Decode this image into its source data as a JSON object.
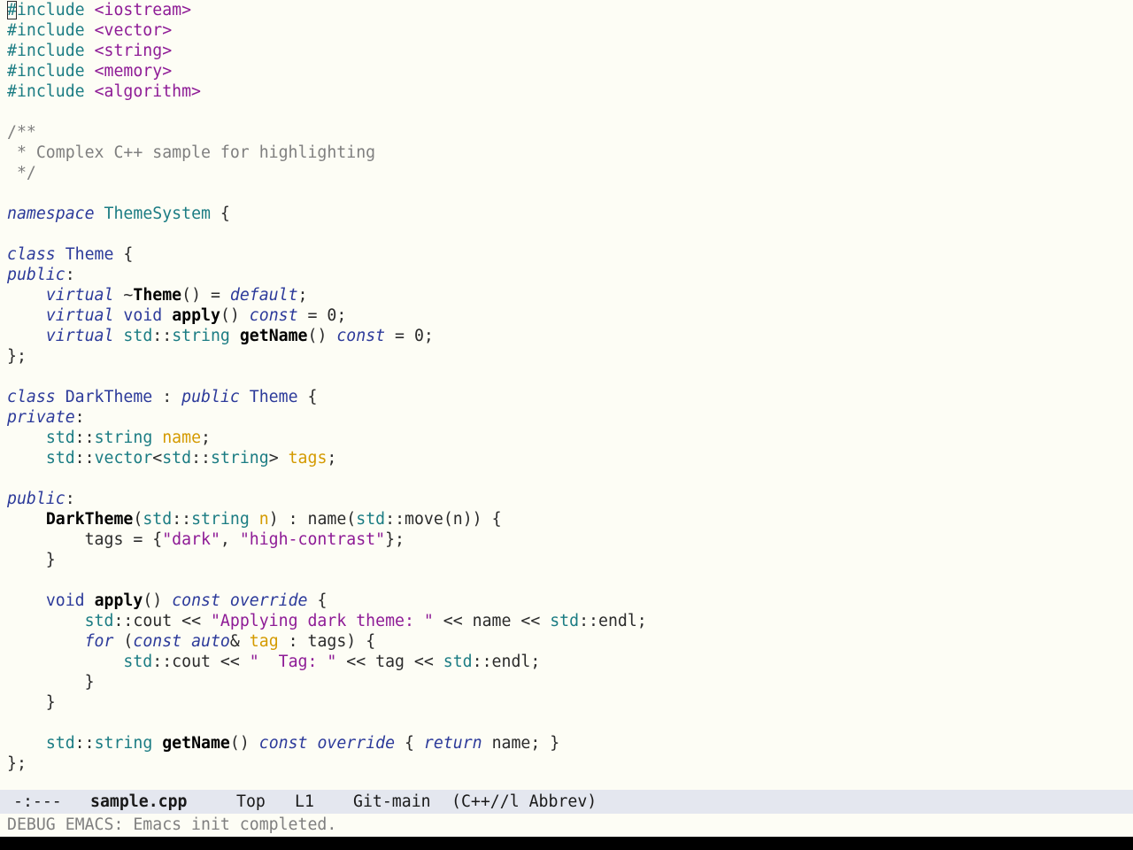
{
  "editor": {
    "lines": [
      [
        {
          "t": "#",
          "c": "pp cursor"
        },
        {
          "t": "include ",
          "c": "pp"
        },
        {
          "t": "<iostream>",
          "c": "str"
        }
      ],
      [
        {
          "t": "#include ",
          "c": "pp"
        },
        {
          "t": "<vector>",
          "c": "str"
        }
      ],
      [
        {
          "t": "#include ",
          "c": "pp"
        },
        {
          "t": "<string>",
          "c": "str"
        }
      ],
      [
        {
          "t": "#include ",
          "c": "pp"
        },
        {
          "t": "<memory>",
          "c": "str"
        }
      ],
      [
        {
          "t": "#include ",
          "c": "pp"
        },
        {
          "t": "<algorithm>",
          "c": "str"
        }
      ],
      [],
      [
        {
          "t": "/**",
          "c": "cm"
        }
      ],
      [
        {
          "t": " * Complex C++ sample for highlighting",
          "c": "cm"
        }
      ],
      [
        {
          "t": " */",
          "c": "cm"
        }
      ],
      [],
      [
        {
          "t": "namespace",
          "c": "kw"
        },
        {
          "t": " "
        },
        {
          "t": "ThemeSystem",
          "c": "ns"
        },
        {
          "t": " {"
        }
      ],
      [],
      [
        {
          "t": "class",
          "c": "kw"
        },
        {
          "t": " "
        },
        {
          "t": "Theme",
          "c": "cls"
        },
        {
          "t": " {"
        }
      ],
      [
        {
          "t": "public",
          "c": "kw"
        },
        {
          "t": ":"
        }
      ],
      [
        {
          "t": "    "
        },
        {
          "t": "virtual",
          "c": "kw"
        },
        {
          "t": " ~"
        },
        {
          "t": "Theme",
          "c": "fn"
        },
        {
          "t": "() = "
        },
        {
          "t": "default",
          "c": "kw"
        },
        {
          "t": ";"
        }
      ],
      [
        {
          "t": "    "
        },
        {
          "t": "virtual",
          "c": "kw"
        },
        {
          "t": " "
        },
        {
          "t": "void",
          "c": "cls"
        },
        {
          "t": " "
        },
        {
          "t": "apply",
          "c": "fn"
        },
        {
          "t": "() "
        },
        {
          "t": "const",
          "c": "kw"
        },
        {
          "t": " = 0;"
        }
      ],
      [
        {
          "t": "    "
        },
        {
          "t": "virtual",
          "c": "kw"
        },
        {
          "t": " "
        },
        {
          "t": "std",
          "c": "ty"
        },
        {
          "t": "::"
        },
        {
          "t": "string",
          "c": "ty"
        },
        {
          "t": " "
        },
        {
          "t": "getName",
          "c": "fn"
        },
        {
          "t": "() "
        },
        {
          "t": "const",
          "c": "kw"
        },
        {
          "t": " = 0;"
        }
      ],
      [
        {
          "t": "};"
        }
      ],
      [],
      [
        {
          "t": "class",
          "c": "kw"
        },
        {
          "t": " "
        },
        {
          "t": "DarkTheme",
          "c": "cls"
        },
        {
          "t": " : "
        },
        {
          "t": "public",
          "c": "kw"
        },
        {
          "t": " "
        },
        {
          "t": "Theme",
          "c": "cls"
        },
        {
          "t": " {"
        }
      ],
      [
        {
          "t": "private",
          "c": "kw"
        },
        {
          "t": ":"
        }
      ],
      [
        {
          "t": "    "
        },
        {
          "t": "std",
          "c": "ty"
        },
        {
          "t": "::"
        },
        {
          "t": "string",
          "c": "ty"
        },
        {
          "t": " "
        },
        {
          "t": "name",
          "c": "var"
        },
        {
          "t": ";"
        }
      ],
      [
        {
          "t": "    "
        },
        {
          "t": "std",
          "c": "ty"
        },
        {
          "t": "::"
        },
        {
          "t": "vector",
          "c": "ty"
        },
        {
          "t": "<"
        },
        {
          "t": "std",
          "c": "ty"
        },
        {
          "t": "::"
        },
        {
          "t": "string",
          "c": "ty"
        },
        {
          "t": "> "
        },
        {
          "t": "tags",
          "c": "var"
        },
        {
          "t": ";"
        }
      ],
      [],
      [
        {
          "t": "public",
          "c": "kw"
        },
        {
          "t": ":"
        }
      ],
      [
        {
          "t": "    "
        },
        {
          "t": "DarkTheme",
          "c": "fn"
        },
        {
          "t": "("
        },
        {
          "t": "std",
          "c": "ty"
        },
        {
          "t": "::"
        },
        {
          "t": "string",
          "c": "ty"
        },
        {
          "t": " "
        },
        {
          "t": "n",
          "c": "var"
        },
        {
          "t": ") : name("
        },
        {
          "t": "std",
          "c": "ty"
        },
        {
          "t": "::move(n)) {"
        }
      ],
      [
        {
          "t": "        tags = {"
        },
        {
          "t": "\"dark\"",
          "c": "str"
        },
        {
          "t": ", "
        },
        {
          "t": "\"high-contrast\"",
          "c": "str"
        },
        {
          "t": "};"
        }
      ],
      [
        {
          "t": "    }"
        }
      ],
      [],
      [
        {
          "t": "    "
        },
        {
          "t": "void",
          "c": "cls"
        },
        {
          "t": " "
        },
        {
          "t": "apply",
          "c": "fn"
        },
        {
          "t": "() "
        },
        {
          "t": "const",
          "c": "kw"
        },
        {
          "t": " "
        },
        {
          "t": "override",
          "c": "kw"
        },
        {
          "t": " {"
        }
      ],
      [
        {
          "t": "        "
        },
        {
          "t": "std",
          "c": "ty"
        },
        {
          "t": "::cout << "
        },
        {
          "t": "\"Applying dark theme: \"",
          "c": "str"
        },
        {
          "t": " << name << "
        },
        {
          "t": "std",
          "c": "ty"
        },
        {
          "t": "::endl;"
        }
      ],
      [
        {
          "t": "        "
        },
        {
          "t": "for",
          "c": "kw"
        },
        {
          "t": " ("
        },
        {
          "t": "const",
          "c": "kw"
        },
        {
          "t": " "
        },
        {
          "t": "auto",
          "c": "kw"
        },
        {
          "t": "& "
        },
        {
          "t": "tag",
          "c": "var"
        },
        {
          "t": " : tags) {"
        }
      ],
      [
        {
          "t": "            "
        },
        {
          "t": "std",
          "c": "ty"
        },
        {
          "t": "::cout << "
        },
        {
          "t": "\"  Tag: \"",
          "c": "str"
        },
        {
          "t": " << tag << "
        },
        {
          "t": "std",
          "c": "ty"
        },
        {
          "t": "::endl;"
        }
      ],
      [
        {
          "t": "        }"
        }
      ],
      [
        {
          "t": "    }"
        }
      ],
      [],
      [
        {
          "t": "    "
        },
        {
          "t": "std",
          "c": "ty"
        },
        {
          "t": "::"
        },
        {
          "t": "string",
          "c": "ty"
        },
        {
          "t": " "
        },
        {
          "t": "getName",
          "c": "fn"
        },
        {
          "t": "() "
        },
        {
          "t": "const",
          "c": "kw"
        },
        {
          "t": " "
        },
        {
          "t": "override",
          "c": "kw"
        },
        {
          "t": " { "
        },
        {
          "t": "return",
          "c": "kw"
        },
        {
          "t": " name; }"
        }
      ],
      [
        {
          "t": "};"
        }
      ]
    ]
  },
  "modeline": {
    "status": "-:---",
    "buffer_name": "sample.cpp",
    "position": "Top",
    "line": "L1",
    "vc": "Git-main",
    "modes": "(C++//l Abbrev)"
  },
  "echo_area": {
    "message": "DEBUG EMACS: Emacs init completed."
  },
  "colors": {
    "background": "#fdfdf5",
    "preprocessor": "#1b7c83",
    "string": "#8e1b96",
    "comment": "#7f7f7f",
    "keyword": "#2c3a9a",
    "type": "#1b7c83",
    "function": "#000000",
    "variable": "#d49a00",
    "modeline_bg": "#e4e7ef"
  }
}
